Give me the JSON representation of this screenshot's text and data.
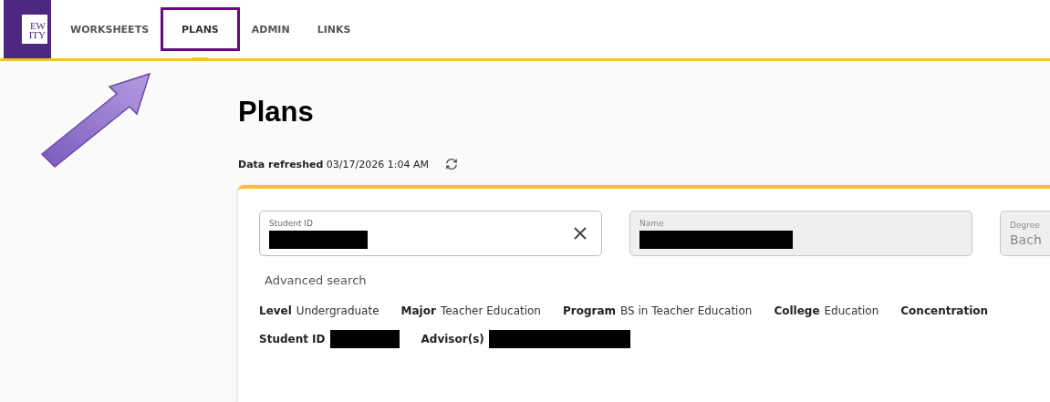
{
  "logo": {
    "lines": [
      "EW",
      "ITY"
    ]
  },
  "tabs": [
    {
      "label": "WORKSHEETS",
      "selected": false,
      "highlighted": false
    },
    {
      "label": "PLANS",
      "selected": true,
      "highlighted": true
    },
    {
      "label": "ADMIN",
      "selected": false,
      "highlighted": false
    },
    {
      "label": "LINKS",
      "selected": false,
      "highlighted": false
    }
  ],
  "page_title": "Plans",
  "data_refreshed": {
    "label": "Data refreshed",
    "value": "03/17/2026 1:04 AM"
  },
  "fields": [
    {
      "label": "Student ID",
      "redacted": true,
      "disabled": false,
      "clearable": true
    },
    {
      "label": "Name",
      "redacted": true,
      "disabled": true
    },
    {
      "label": "Degree",
      "value": "Bach",
      "disabled": true
    }
  ],
  "advanced_search": "Advanced search",
  "details": [
    [
      {
        "label": "Level",
        "value": "Undergraduate"
      },
      {
        "label": "Major",
        "value": "Teacher Education"
      },
      {
        "label": "Program",
        "value": "BS in Teacher Education"
      },
      {
        "label": "College",
        "value": "Education"
      },
      {
        "label": "Concentration"
      }
    ],
    [
      {
        "label": "Student ID",
        "redacted": true
      },
      {
        "label": "Advisor(s)",
        "redacted": true
      }
    ]
  ]
}
